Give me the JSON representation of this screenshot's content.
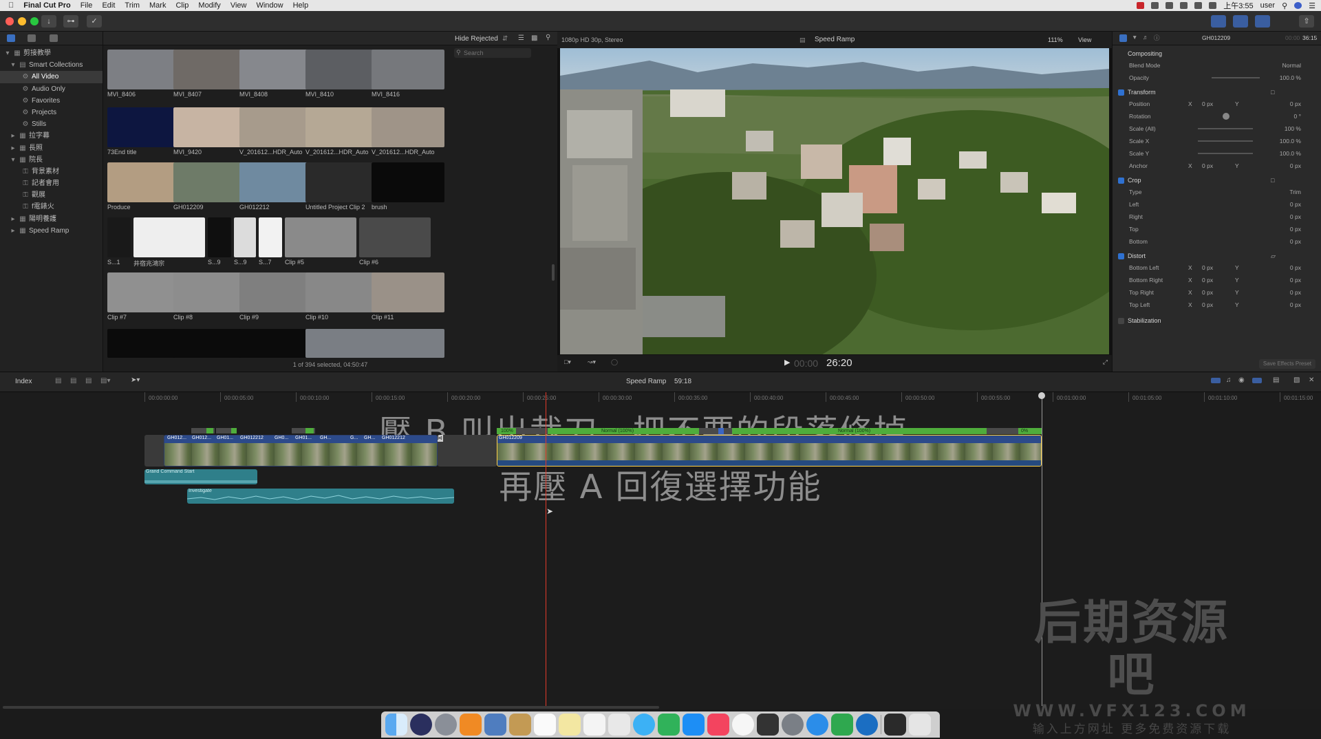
{
  "menubar": {
    "app_name": "Final Cut Pro",
    "items": [
      "File",
      "Edit",
      "Trim",
      "Mark",
      "Clip",
      "Modify",
      "View",
      "Window",
      "Help"
    ],
    "time": "上午3:55",
    "user": "user"
  },
  "library": {
    "root": "剪接教學",
    "smart_collections": "Smart Collections",
    "items": [
      "All Video",
      "Audio Only",
      "Favorites",
      "Projects",
      "Stills"
    ],
    "events": [
      "拉字幕",
      "長照",
      "院長"
    ],
    "sub_events": [
      "背景素材",
      "記者會用",
      "觀展",
      "f電錶火"
    ],
    "more_events": [
      "陽明養護",
      "Speed Ramp"
    ]
  },
  "browser": {
    "filter_label": "Hide Rejected",
    "search_placeholder": "Search",
    "clips": [
      {
        "label": "MVI_8406",
        "color": "#7d7f84"
      },
      {
        "label": "MVI_8407",
        "color": "#6f6a66"
      },
      {
        "label": "MVI_8408",
        "color": "#86888d"
      },
      {
        "label": "MVI_8410",
        "color": "#5c5e62"
      },
      {
        "label": "MVI_8416",
        "color": "#76787c"
      },
      {
        "label": "73End title",
        "color": "#0d1640"
      },
      {
        "label": "MVI_9420",
        "color": "#c7b4a3"
      },
      {
        "label": "V_201612...HDR_Auto",
        "color": "#a79b8c"
      },
      {
        "label": "V_201612...HDR_Auto",
        "color": "#b5a895"
      },
      {
        "label": "V_201612...HDR_Auto",
        "color": "#9f9488"
      },
      {
        "label": "Produce",
        "color": "#b39d82"
      },
      {
        "label": "GH012209",
        "color": "#6e7b68"
      },
      {
        "label": "GH012212",
        "color": "#6f8aa0"
      },
      {
        "label": "Untitled Project Clip 2",
        "color": "#2a2a2a"
      },
      {
        "label": "brush",
        "color": "#0a0a0a"
      },
      {
        "label": "S...1",
        "color": "#191919"
      },
      {
        "label": "井宿兆鴻宗",
        "color": "#eeeeee"
      },
      {
        "label": "S...9",
        "color": "#0f0f0f"
      },
      {
        "label": "S...9",
        "color": "#dcdcdc"
      },
      {
        "label": "S...7",
        "color": "#f2f2f2"
      },
      {
        "label": "Clip #5",
        "color": "#8a8a8a"
      },
      {
        "label": "Clip #6",
        "color": "#4a4a4a"
      },
      {
        "label": "Clip #7",
        "color": "#909090"
      },
      {
        "label": "Clip #8",
        "color": "#8d8d8d"
      },
      {
        "label": "Clip #9",
        "color": "#7f7f7f"
      },
      {
        "label": "Clip #10",
        "color": "#888888"
      },
      {
        "label": "Clip #11",
        "color": "#9a9188"
      }
    ],
    "footer": "1 of 394 selected, 04:50:47"
  },
  "viewer": {
    "format": "1080p HD 30p, Stereo",
    "title": "Speed Ramp",
    "zoom": "111%",
    "view_label": "View",
    "timecode_prefix": "00:00",
    "timecode": "26:20"
  },
  "inspector": {
    "clip_name": "GH012209",
    "duration_prefix": "00:00",
    "duration": "36:15",
    "compositing": "Compositing",
    "blend_mode_label": "Blend Mode",
    "blend_mode_value": "Normal",
    "opacity_label": "Opacity",
    "opacity_value": "100.0 %",
    "transform": "Transform",
    "position_label": "Position",
    "rotation_label": "Rotation",
    "rotation_value": "0 °",
    "scale_all_label": "Scale (All)",
    "scale_all_value": "100 %",
    "scale_x_label": "Scale X",
    "scale_x_value": "100.0 %",
    "scale_y_label": "Scale Y",
    "scale_y_value": "100.0 %",
    "anchor_label": "Anchor",
    "x_label": "X",
    "y_label": "Y",
    "zero_px": "0 px",
    "crop": "Crop",
    "type_label": "Type",
    "type_value": "Trim",
    "left_label": "Left",
    "right_label": "Right",
    "top_label": "Top",
    "bottom_label": "Bottom",
    "distort": "Distort",
    "bottom_left_label": "Bottom Left",
    "bottom_right_label": "Bottom Right",
    "top_right_label": "Top Right",
    "top_left_label": "Top Left",
    "stabilization": "Stabilization",
    "save_preset": "Save Effects Preset"
  },
  "timeline": {
    "index_label": "Index",
    "project_name": "Speed Ramp",
    "project_duration": "59:18",
    "ruler": [
      "00:00:00:00",
      "00:00:05:00",
      "00:00:10:00",
      "00:00:15:00",
      "00:00:20:00",
      "00:00:25:00",
      "00:00:30:00",
      "00:00:35:00",
      "00:00:40:00",
      "00:00:45:00",
      "00:00:50:00",
      "00:00:55:00",
      "00:01:00:00",
      "00:01:05:00",
      "00:01:10:00",
      "00:01:15:00"
    ],
    "subtitle_line1": "壓 B 叫出裁刀，把不要的段落修掉。",
    "subtitle_line2": "再壓 A 回復選擇功能",
    "left_clip_labels": [
      "GH012...",
      "GH012...",
      "GH01...",
      "GH012212",
      "GH0...",
      "GH01...",
      "GH...",
      "G...",
      "GH...",
      "GH012212"
    ],
    "main_clip": "GH012209",
    "speed_start": "100%",
    "speed_mid1": "Normal (100%)",
    "speed_mid2": "Normal (100%)",
    "speed_end": "0%",
    "audio1": "Grand Command Start",
    "audio2": "Investigate"
  },
  "watermark": {
    "line1": "后期资源吧",
    "line2": "WWW.VFX123.COM",
    "line3": "输入上方网址 更多免费资源下载"
  },
  "colors": {
    "accent_blue": "#2f71d1",
    "playhead": "#e3392a",
    "speed_green": "#4fad3c",
    "audio_teal": "#2f7f8a"
  }
}
